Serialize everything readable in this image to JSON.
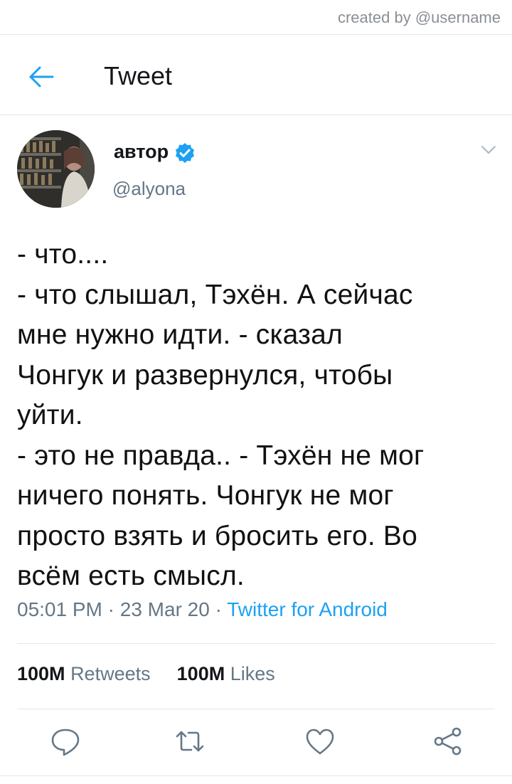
{
  "watermark": "created by @username",
  "header": {
    "title": "Tweet",
    "back_icon": "arrow-left-icon"
  },
  "author": {
    "name": "автор",
    "handle": "@alyona",
    "verified": true,
    "avatar": "profile-photo"
  },
  "tweet": {
    "lines": [
      "- что....",
      "- что слышал, Тэхён. А сейчас",
      "мне нужно идти. - сказал",
      "Чонгук и развернулся, чтобы",
      "уйти.",
      "- это не правда.. - Тэхён не мог",
      "ничего понять. Чонгук не мог",
      "просто взять и бросить его. Во",
      "всём есть смысл."
    ],
    "time": "05:01 PM",
    "date": "23 Mar 20",
    "separator": "·",
    "source": "Twitter for Android"
  },
  "stats": {
    "retweets_count": "100M",
    "retweets_label": "Retweets",
    "likes_count": "100M",
    "likes_label": "Likes"
  },
  "actions": [
    "reply-icon",
    "retweet-icon",
    "like-icon",
    "share-icon"
  ],
  "colors": {
    "accent": "#1da1f2",
    "muted": "#657786",
    "divider": "#e3e6e8"
  }
}
